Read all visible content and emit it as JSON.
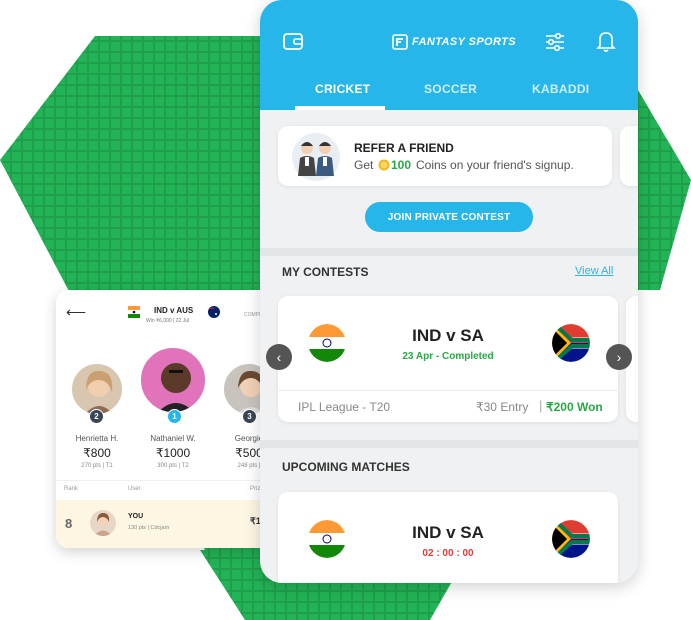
{
  "colors": {
    "accent": "#26b6ea",
    "green": "#1fa54a",
    "won": "#28a745",
    "countdown": "#e53935"
  },
  "leaderboard": {
    "match_title": "IND v AUS",
    "match_sub": "Win ₹6,000 | 22 Jul",
    "comp_label": "COMPL",
    "podium": [
      {
        "rank": "2",
        "name": "Henrietta H.",
        "amount": "₹800",
        "meta": "270 pts | T1"
      },
      {
        "rank": "1",
        "name": "Nathaniel W.",
        "amount": "₹1000",
        "meta": "300 pts | T2"
      },
      {
        "rank": "3",
        "name": "Georgie",
        "amount": "₹500",
        "meta": "248 pts |"
      }
    ],
    "col_rank": "Rank",
    "col_user": "User",
    "col_prize": "Priz",
    "row": {
      "rank": "8",
      "name": "YOU",
      "meta": "130 pts | Cdcjam",
      "prize": "₹1"
    }
  },
  "app": {
    "logo": "FANTASY SPORTS",
    "tabs": [
      "CRICKET",
      "SOCCER",
      "KABADDI"
    ],
    "refer": {
      "title": "REFER A FRIEND",
      "text_pre": "Get",
      "coins": "100",
      "text_post": "Coins on your friend's signup."
    },
    "join_label": "JOIN PRIVATE CONTEST",
    "my_contests": {
      "heading": "MY CONTESTS",
      "view_all": "View All"
    },
    "contest": {
      "teams": "IND v SA",
      "status": "23 Apr - Completed",
      "league": "IPL League - T20",
      "entry": "₹30 Entry",
      "won": "₹200 Won"
    },
    "upcoming": {
      "heading": "UPCOMING MATCHES",
      "teams": "IND v SA",
      "countdown": "02 : 00 : 00"
    }
  }
}
